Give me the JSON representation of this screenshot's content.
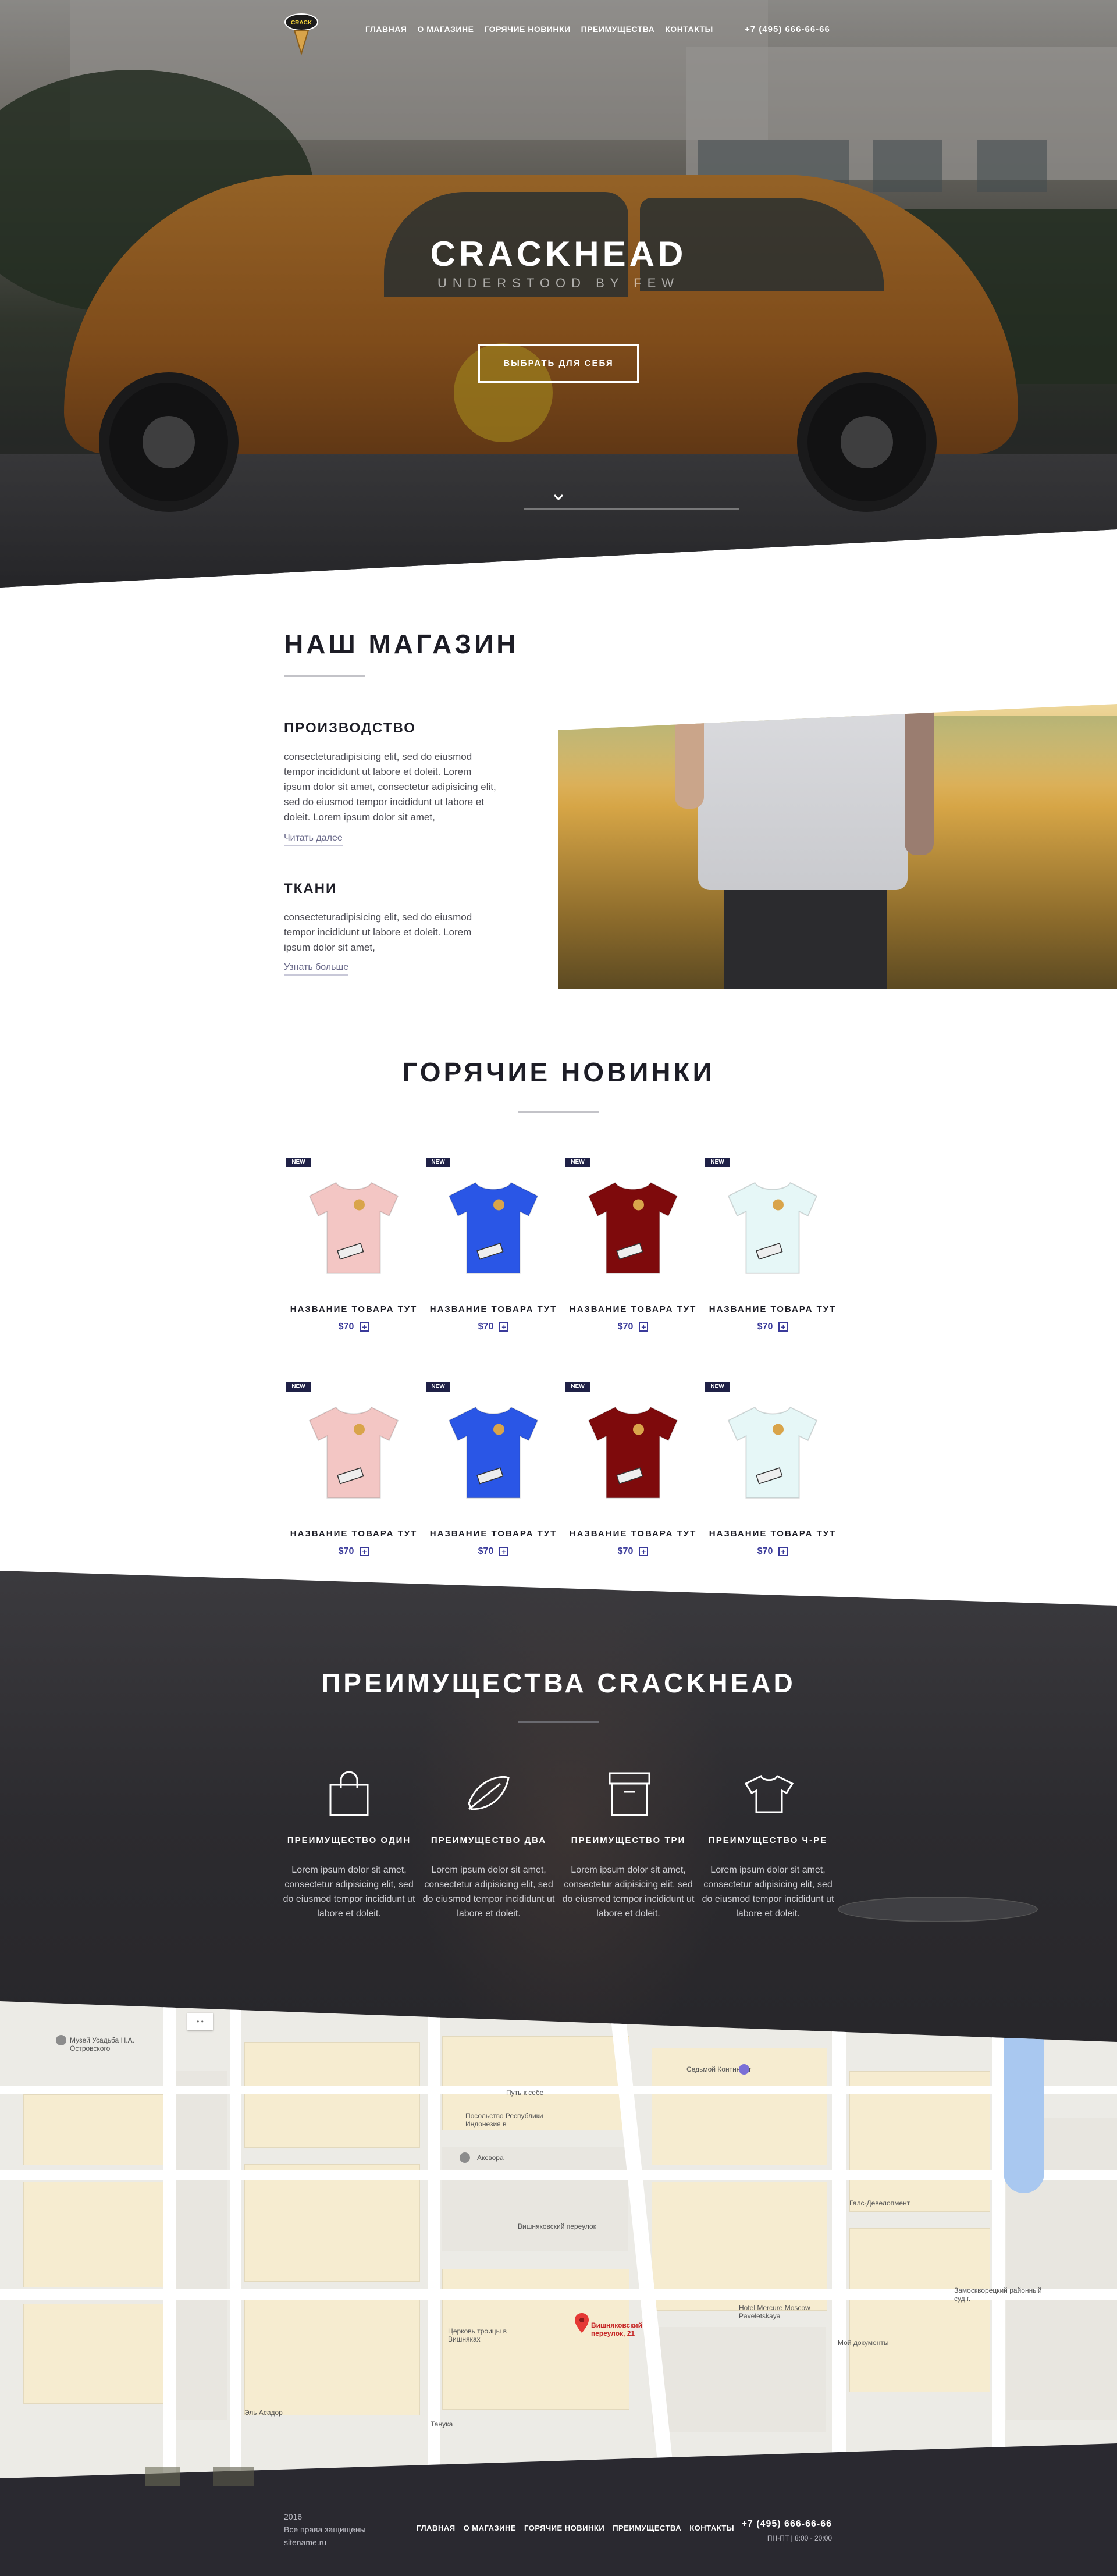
{
  "header": {
    "logo_text": "CRACKHEAD",
    "nav": [
      "ГЛАВНАЯ",
      "О МАГАЗИНЕ",
      "ГОРЯЧИЕ НОВИНКИ",
      "ПРЕИМУЩЕСТВА",
      "КОНТАКТЫ"
    ],
    "phone": "+7 (495) 666-66-66"
  },
  "hero": {
    "title": "CRACKHEAD",
    "subtitle": "UNDERSTOOD BY FEW",
    "button": "ВЫБРАТЬ ДЛЯ СЕБЯ"
  },
  "store": {
    "title": "НАШ МАГАЗИН",
    "blocks": [
      {
        "heading": "ПРОИЗВОДСТВО",
        "text": "consecteturadipisicing elit, sed do eiusmod tempor incididunt ut labore et doleit. Lorem ipsum dolor sit amet, consectetur adipisicing elit, sed do eiusmod tempor incididunt ut labore et doleit. Lorem ipsum dolor sit amet,",
        "link": "Читать далее"
      },
      {
        "heading": "ТКАНИ",
        "text": "consecteturadipisicing elit, sed do eiusmod tempor incididunt ut labore et doleit. Lorem ipsum dolor sit amet,",
        "link": "Узнать больше"
      }
    ]
  },
  "products": {
    "title": "ГОРЯЧИЕ НОВИНКИ",
    "badge": "NEW",
    "items": [
      {
        "name": "НАЗВАНИЕ ТОВАРА ТУТ",
        "price": "$70",
        "color": "#f3c6c4"
      },
      {
        "name": "НАЗВАНИЕ ТОВАРА ТУТ",
        "price": "$70",
        "color": "#2a56e6"
      },
      {
        "name": "НАЗВАНИЕ ТОВАРА ТУТ",
        "price": "$70",
        "color": "#7e0a0c"
      },
      {
        "name": "НАЗВАНИЕ ТОВАРА ТУТ",
        "price": "$70",
        "color": "#e6f7f7"
      },
      {
        "name": "НАЗВАНИЕ ТОВАРА ТУТ",
        "price": "$70",
        "color": "#f3c6c4"
      },
      {
        "name": "НАЗВАНИЕ ТОВАРА ТУТ",
        "price": "$70",
        "color": "#2a56e6"
      },
      {
        "name": "НАЗВАНИЕ ТОВАРА ТУТ",
        "price": "$70",
        "color": "#7e0a0c"
      },
      {
        "name": "НАЗВАНИЕ ТОВАРА ТУТ",
        "price": "$70",
        "color": "#e6f7f7"
      }
    ],
    "plus": "+"
  },
  "advantages": {
    "title": "ПРЕИМУЩЕСТВА CRACKHEAD",
    "items": [
      {
        "icon": "shopping-bag-icon",
        "label": "ПРЕИМУЩЕСТВО ОДИН",
        "text": "Lorem ipsum dolor sit amet, consectetur adipisicing elit, sed do eiusmod tempor incididunt ut labore et doleit."
      },
      {
        "icon": "feather-icon",
        "label": "ПРЕИМУЩЕСТВО ДВА",
        "text": "Lorem ipsum dolor sit amet, consectetur adipisicing elit, sed do eiusmod tempor incididunt ut labore et doleit."
      },
      {
        "icon": "box-icon",
        "label": "ПРЕИМУЩЕСТВО ТРИ",
        "text": "Lorem ipsum dolor sit amet, consectetur adipisicing elit, sed do eiusmod tempor incididunt ut labore et doleit."
      },
      {
        "icon": "tshirt-icon",
        "label": "ПРЕИМУЩЕСТВО Ч-РЕ",
        "text": "Lorem ipsum dolor sit amet, consectetur adipisicing elit, sed do eiusmod tempor incididunt ut labore et doleit."
      }
    ]
  },
  "map": {
    "labels": [
      "Музей Усадьба Н.А. Островского",
      "Путь к себе",
      "Посольство Республики Индонезия в",
      "Аксвора",
      "Седьмой Континент",
      "Галс-Девелопмент",
      "Вишняковский переулок",
      "Вишняковский переулок, 21",
      "Церковь троицы в Вишняках",
      "Hotel Mercure Moscow Paveletskaya",
      "Мой документы",
      "Эль Асадор",
      "Танука",
      "Замоскворецкий районный суд г."
    ],
    "pin": "Вишняковский переулок, 21"
  },
  "footer": {
    "year": "2016",
    "rights": "Все права защищены",
    "site": "sitename.ru",
    "nav": [
      "ГЛАВНАЯ",
      "О МАГАЗИНЕ",
      "ГОРЯЧИЕ НОВИНКИ",
      "ПРЕИМУЩЕСТВА",
      "КОНТАКТЫ"
    ],
    "phone": "+7 (495) 666-66-66",
    "hours": "ПН-ПТ | 8:00 - 20:00"
  },
  "colors": {
    "accent": "#3a3a9a",
    "badge": "#1f2147",
    "dark": "#2a2930"
  }
}
